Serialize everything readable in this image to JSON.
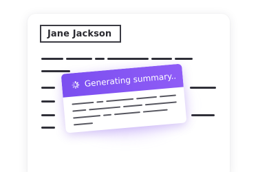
{
  "document": {
    "name": "Jane Jackson"
  },
  "summary_popup": {
    "status_text": "Generating summary..",
    "accent_color": "#7b4ff0",
    "icon": "spinner-icon"
  }
}
